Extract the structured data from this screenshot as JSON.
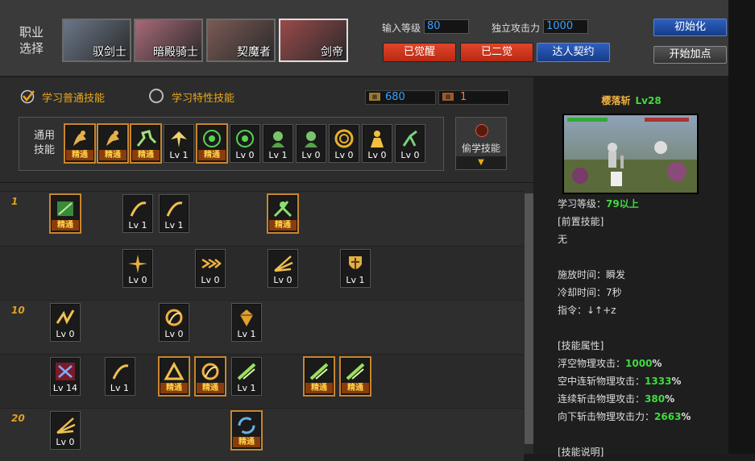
{
  "job": {
    "label": "职业\n选择",
    "items": [
      {
        "name": "驭剑士",
        "selected": false,
        "color": "#6b7788"
      },
      {
        "name": "暗殿骑士",
        "selected": false,
        "color": "#a86a78"
      },
      {
        "name": "契魔者",
        "selected": false,
        "color": "#7a5a55"
      },
      {
        "name": "剑帝",
        "selected": true,
        "color": "#9a4a4a"
      }
    ]
  },
  "controls": {
    "level_label": "输入等级",
    "level_value": "80",
    "atk_label": "独立攻击力",
    "atk_value": "1000",
    "btn_awake": "已觉醒",
    "btn_awake2": "已二觉",
    "btn_contract": "达人契约",
    "btn_init": "初始化",
    "btn_start": "开始加点"
  },
  "tabs": {
    "normal": "学习普通技能",
    "trait": "学习特性技能"
  },
  "sp": {
    "sp_value": "680",
    "tp_value": "1"
  },
  "general": {
    "label": "通用\n技能",
    "steal": "偷学技能",
    "items": [
      {
        "cap": "精通",
        "gold": true,
        "icon": "sit"
      },
      {
        "cap": "精通",
        "gold": true,
        "icon": "sit"
      },
      {
        "cap": "精通",
        "gold": true,
        "icon": "run"
      },
      {
        "cap": "Lv 1",
        "gold": false,
        "icon": "wing"
      },
      {
        "cap": "精通",
        "gold": true,
        "icon": "target"
      },
      {
        "cap": "Lv 0",
        "gold": false,
        "icon": "target"
      },
      {
        "cap": "Lv 1",
        "gold": false,
        "icon": "head"
      },
      {
        "cap": "Lv 0",
        "gold": false,
        "icon": "head"
      },
      {
        "cap": "Lv 0",
        "gold": false,
        "icon": "ring"
      },
      {
        "cap": "Lv 0",
        "gold": false,
        "icon": "man"
      },
      {
        "cap": "Lv 0",
        "gold": false,
        "icon": "kick"
      }
    ]
  },
  "tree": {
    "levels": [
      "1",
      "10",
      "20"
    ],
    "rows": [
      [
        {
          "col": 0,
          "cap": "精通",
          "gold": true,
          "icon": "green"
        },
        {
          "col": 2,
          "cap": "Lv 1",
          "gold": false,
          "icon": "slash"
        },
        {
          "col": 3,
          "cap": "Lv 1",
          "gold": false,
          "icon": "slash"
        },
        {
          "col": 6,
          "cap": "精通",
          "gold": true,
          "icon": "greenman"
        }
      ],
      [
        {
          "col": 2,
          "cap": "Lv 0",
          "gold": false,
          "icon": "burst"
        },
        {
          "col": 4,
          "cap": "Lv 0",
          "gold": false,
          "icon": "arrows"
        },
        {
          "col": 6,
          "cap": "Lv 0",
          "gold": false,
          "icon": "fan"
        },
        {
          "col": 8,
          "cap": "Lv 1",
          "gold": false,
          "icon": "shield"
        }
      ],
      [
        {
          "col": 0,
          "cap": "Lv 0",
          "gold": false,
          "icon": "zig"
        },
        {
          "col": 3,
          "cap": "Lv 0",
          "gold": false,
          "icon": "circle"
        },
        {
          "col": 5,
          "cap": "Lv 1",
          "gold": false,
          "icon": "gem"
        }
      ],
      [
        {
          "col": 0,
          "cap": "Lv 14",
          "gold": false,
          "icon": "cross"
        },
        {
          "col": 1.5,
          "cap": "Lv 1",
          "gold": false,
          "icon": "slash"
        },
        {
          "col": 3,
          "cap": "精通",
          "gold": true,
          "icon": "tri"
        },
        {
          "col": 4,
          "cap": "精通",
          "gold": true,
          "icon": "circle"
        },
        {
          "col": 5,
          "cap": "Lv 1",
          "gold": false,
          "icon": "greenslash"
        },
        {
          "col": 7,
          "cap": "精通",
          "gold": true,
          "icon": "greenslash"
        },
        {
          "col": 8,
          "cap": "精通",
          "gold": true,
          "icon": "greenslash"
        }
      ],
      [
        {
          "col": 0,
          "cap": "Lv 0",
          "gold": false,
          "icon": "fan"
        },
        {
          "col": 5,
          "cap": "精通",
          "gold": true,
          "icon": "swirl"
        }
      ]
    ]
  },
  "detail": {
    "name": "樱落斩",
    "lv": "Lv28",
    "learn_label": "学习等级：",
    "learn_value": "79以上",
    "pre_label": "[前置技能]",
    "pre_value": "无",
    "cast": "施放时间：瞬发",
    "cool": "冷却时间：7秒",
    "cmd": "指令：↓↑+z",
    "attr_label": "[技能属性]",
    "attrs": [
      {
        "k": "浮空物理攻击：",
        "v": "1000",
        "u": "%"
      },
      {
        "k": "空中连斩物理攻击：",
        "v": "1333",
        "u": "%"
      },
      {
        "k": "连续斩击物理攻击：",
        "v": "380",
        "u": "%"
      },
      {
        "k": "向下斩击物理攻击力：",
        "v": "2663",
        "u": "%"
      }
    ],
    "desc_label": "[技能说明]"
  }
}
